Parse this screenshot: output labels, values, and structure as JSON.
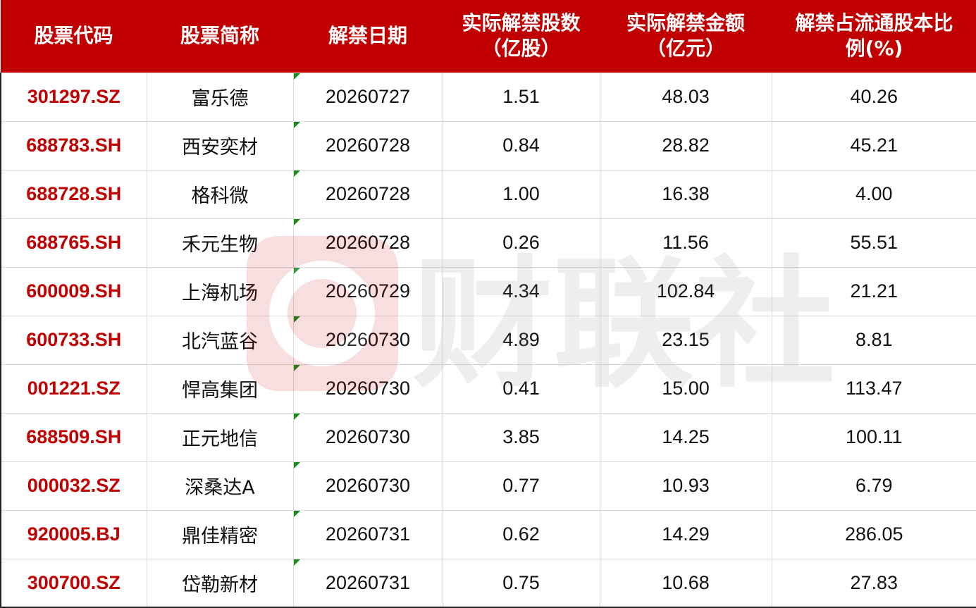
{
  "header": {
    "code": "股票代码",
    "name": "股票简称",
    "date": "解禁日期",
    "shares_line1": "实际解禁股数",
    "shares_line2": "（亿股）",
    "amount_line1": "实际解禁金额",
    "amount_line2": "（亿元）",
    "ratio_line1": "解禁占流通股本比",
    "ratio_line2": "例(%)"
  },
  "rows": [
    {
      "code": "301297.SZ",
      "name": "富乐德",
      "date": "20260727",
      "shares": "1.51",
      "amount": "48.03",
      "ratio": "40.26"
    },
    {
      "code": "688783.SH",
      "name": "西安奕材",
      "date": "20260728",
      "shares": "0.84",
      "amount": "28.82",
      "ratio": "45.21"
    },
    {
      "code": "688728.SH",
      "name": "格科微",
      "date": "20260728",
      "shares": "1.00",
      "amount": "16.38",
      "ratio": "4.00"
    },
    {
      "code": "688765.SH",
      "name": "禾元生物",
      "date": "20260728",
      "shares": "0.26",
      "amount": "11.56",
      "ratio": "55.51"
    },
    {
      "code": "600009.SH",
      "name": "上海机场",
      "date": "20260729",
      "shares": "4.34",
      "amount": "102.84",
      "ratio": "21.21"
    },
    {
      "code": "600733.SH",
      "name": "北汽蓝谷",
      "date": "20260730",
      "shares": "4.89",
      "amount": "23.15",
      "ratio": "8.81"
    },
    {
      "code": "001221.SZ",
      "name": "悍高集团",
      "date": "20260730",
      "shares": "0.41",
      "amount": "15.00",
      "ratio": "113.47"
    },
    {
      "code": "688509.SH",
      "name": "正元地信",
      "date": "20260730",
      "shares": "3.85",
      "amount": "14.25",
      "ratio": "100.11"
    },
    {
      "code": "000032.SZ",
      "name": "深桑达A",
      "date": "20260730",
      "shares": "0.77",
      "amount": "10.93",
      "ratio": "6.79"
    },
    {
      "code": "920005.BJ",
      "name": "鼎佳精密",
      "date": "20260731",
      "shares": "0.62",
      "amount": "14.29",
      "ratio": "286.05"
    },
    {
      "code": "300700.SZ",
      "name": "岱勒新材",
      "date": "20260731",
      "shares": "0.75",
      "amount": "10.68",
      "ratio": "27.83"
    }
  ],
  "watermark": {
    "text": "财联社"
  },
  "colors": {
    "header_bg": "#c00000",
    "code_text": "#c00000",
    "marker": "#1a8a1a"
  }
}
